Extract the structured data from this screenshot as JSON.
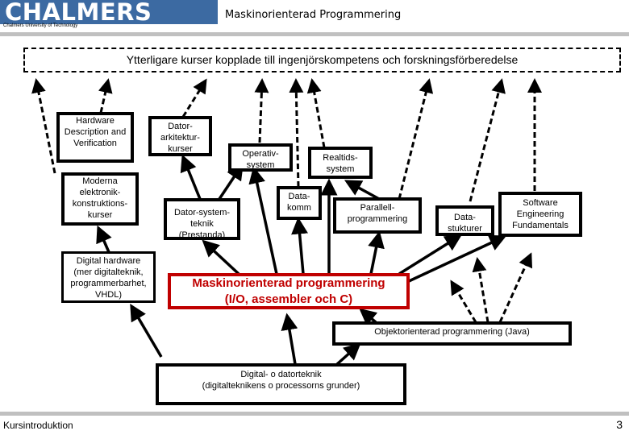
{
  "header": {
    "logo": "CHALMERS",
    "logo_subtitle": "Chalmers University of Technology",
    "title": "Maskinorienterad Programmering",
    "brand_color": "#3c6aa2"
  },
  "diagram": {
    "top_box": "Ytterligare kurser kopplade till ingenjörskompetens och forskningsförberedelse",
    "nodes": {
      "hdv": "Hardware\nDescription and\nVerification",
      "dark": "Dator-\narkitektur-\nkurser",
      "os": "Operativ-\nsystem",
      "rts": "Realtids-\nsystem",
      "mek": "Moderna\nelektronik-\nkonstruktions-\nkurser",
      "dst": "Dator-system-\nteknik\n(Prestanda)",
      "dkomm": "Data-\nkomm",
      "par": "Parallell-\nprogrammering",
      "dstruct": "Data-\nstukturer",
      "sef": "Software\nEngineering\nFundamentals",
      "dhw": "Digital hardware\n(mer digitalteknik,\nprogrammerbarhet,\nVHDL)",
      "mop": "Maskinorienterad programmering\n(I/O, assembler och C)",
      "oop": "Objektorienterad programmering (Java)",
      "dig": "Digital- o datorteknik\n(digitalteknikens o processorns grunder)"
    },
    "highlight_color": "#c00000"
  },
  "footer": {
    "section": "Kursintroduktion",
    "page_number": "3"
  }
}
